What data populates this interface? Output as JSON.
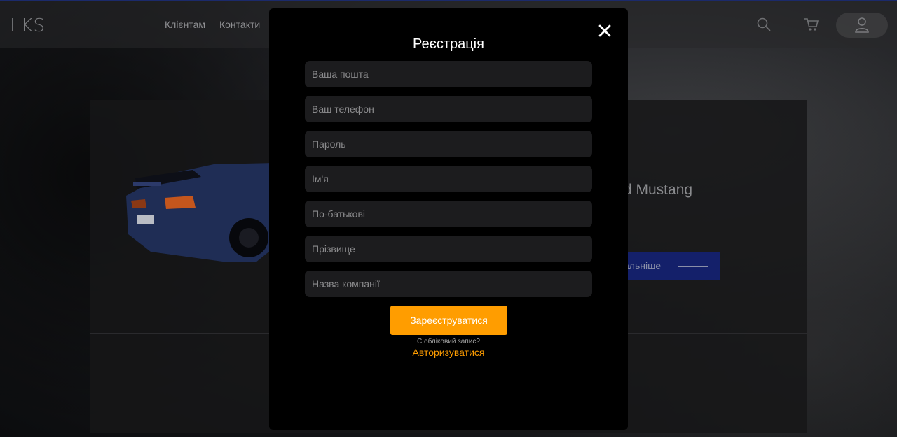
{
  "header": {
    "logo": "LKS",
    "nav": [
      "Клієнтам",
      "Контакти"
    ]
  },
  "card": {
    "title_fragment": "d Mustang",
    "button_fragment": "альніше"
  },
  "modal": {
    "title": "Реєстрація",
    "fields": [
      {
        "name": "email-field",
        "placeholder": "Ваша пошта"
      },
      {
        "name": "phone-field",
        "placeholder": "Ваш телефон"
      },
      {
        "name": "password-field",
        "placeholder": "Пароль"
      },
      {
        "name": "first-name-field",
        "placeholder": "Ім'я"
      },
      {
        "name": "patronymic-field",
        "placeholder": "По-батькові"
      },
      {
        "name": "last-name-field",
        "placeholder": "Прізвище"
      },
      {
        "name": "company-field",
        "placeholder": "Назва компанії"
      }
    ],
    "submit_label": "Зареєструватися",
    "have_account_text": "Є обліковий запис?",
    "login_link": "Авторизуватися"
  },
  "colors": {
    "accent": "#ff9d00",
    "modal_bg": "#000000",
    "input_bg": "#1c1c1e",
    "button_blue": "#14206a"
  },
  "icons": [
    "search-icon",
    "cart-icon",
    "user-icon",
    "close-icon"
  ]
}
